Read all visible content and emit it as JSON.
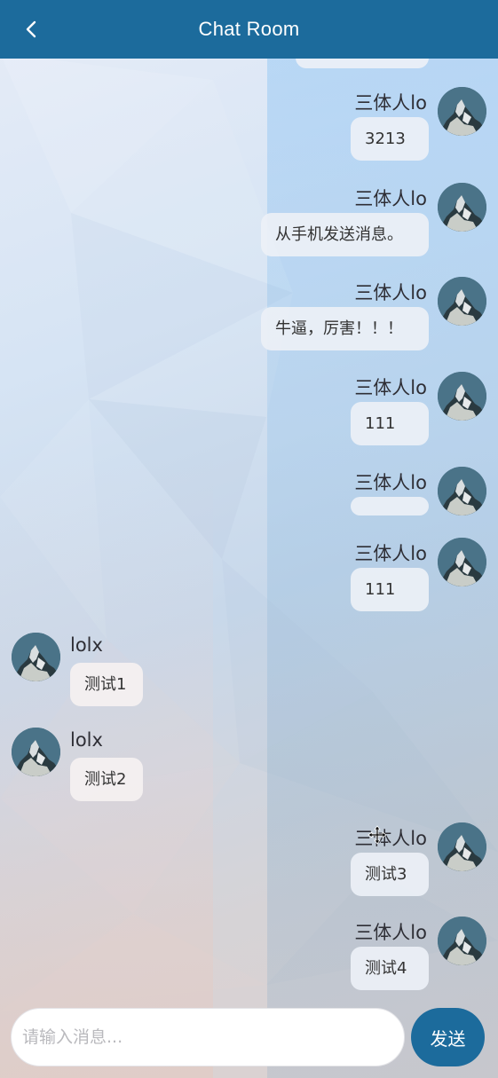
{
  "header": {
    "title": "Chat Room"
  },
  "messages": [
    {
      "side": "right",
      "name": "三体人lo",
      "text": "3213"
    },
    {
      "side": "right",
      "name": "三体人lo",
      "text": "从手机发送消息。"
    },
    {
      "side": "right",
      "name": "三体人lo",
      "text": "牛逼，厉害！！！"
    },
    {
      "side": "right",
      "name": "三体人lo",
      "text": "111"
    },
    {
      "side": "right",
      "name": "三体人lo",
      "text": ""
    },
    {
      "side": "right",
      "name": "三体人lo",
      "text": "111"
    },
    {
      "side": "left",
      "name": "lolx",
      "text": "测试1"
    },
    {
      "side": "left",
      "name": "lolx",
      "text": "测试2"
    },
    {
      "side": "right",
      "name": "三体人lo",
      "text": "测试3"
    },
    {
      "side": "right",
      "name": "三体人lo",
      "text": "测试4"
    }
  ],
  "input": {
    "placeholder": "请输入消息..."
  },
  "send_label": "发送",
  "colors": {
    "primary": "#1c6b9c"
  }
}
